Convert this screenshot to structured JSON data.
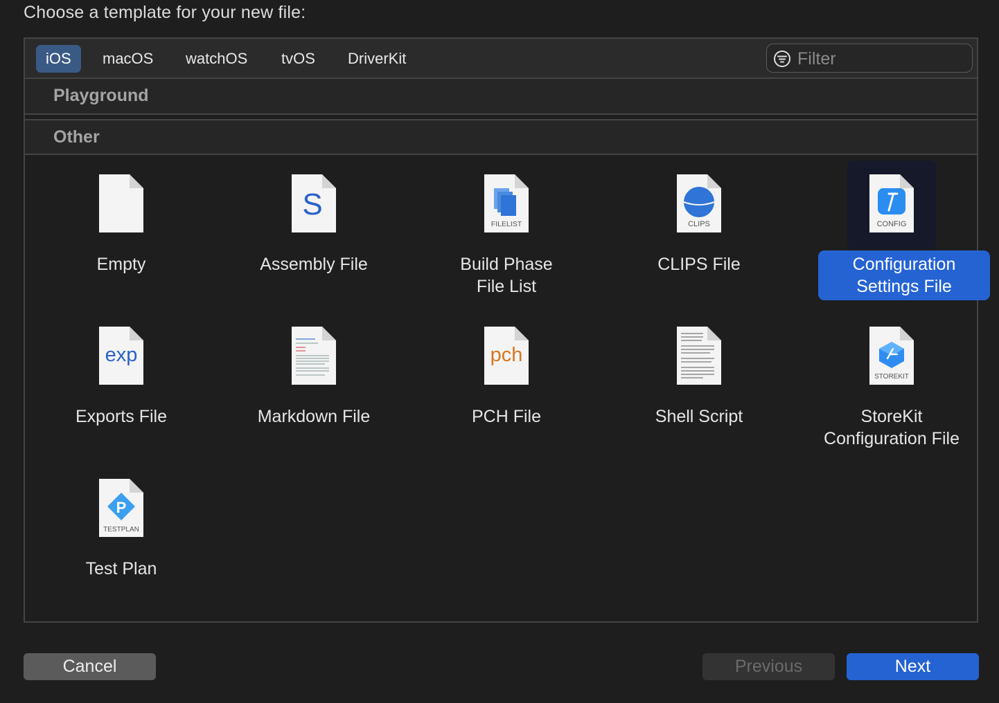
{
  "heading": "Choose a template for your new file:",
  "platform_tabs": [
    {
      "label": "iOS",
      "selected": true
    },
    {
      "label": "macOS",
      "selected": false
    },
    {
      "label": "watchOS",
      "selected": false
    },
    {
      "label": "tvOS",
      "selected": false
    },
    {
      "label": "DriverKit",
      "selected": false
    }
  ],
  "filter": {
    "placeholder": "Filter",
    "value": ""
  },
  "sections": [
    {
      "label": "Playground"
    },
    {
      "label": "Other"
    }
  ],
  "templates": [
    {
      "caption": "Empty",
      "icon": "empty-file-icon",
      "badge": "",
      "selected": false
    },
    {
      "caption": "Assembly File",
      "icon": "assembly-file-icon",
      "badge": "S",
      "selected": false
    },
    {
      "caption": "Build Phase File List",
      "icon": "filelist-file-icon",
      "badge": "FILELIST",
      "selected": false
    },
    {
      "caption": "CLIPS File",
      "icon": "clips-file-icon",
      "badge": "CLIPS",
      "selected": false
    },
    {
      "caption": "Configuration Settings File",
      "icon": "config-file-icon",
      "badge": "CONFIG",
      "selected": true
    },
    {
      "caption": "Exports File",
      "icon": "exports-file-icon",
      "badge": "exp",
      "selected": false
    },
    {
      "caption": "Markdown File",
      "icon": "markdown-file-icon",
      "badge": "",
      "selected": false
    },
    {
      "caption": "PCH File",
      "icon": "pch-file-icon",
      "badge": "pch",
      "selected": false
    },
    {
      "caption": "Shell Script",
      "icon": "shell-script-file-icon",
      "badge": "",
      "selected": false
    },
    {
      "caption": "StoreKit Configuration File",
      "icon": "storekit-file-icon",
      "badge": "STOREKIT",
      "selected": false
    },
    {
      "caption": "Test Plan",
      "icon": "testplan-file-icon",
      "badge": "TESTPLAN",
      "selected": false
    }
  ],
  "buttons": {
    "cancel": "Cancel",
    "previous": "Previous",
    "next": "Next"
  },
  "colors": {
    "accent": "#2563d3",
    "tab_selected": "#3a5a86",
    "background": "#1e1e1e"
  }
}
